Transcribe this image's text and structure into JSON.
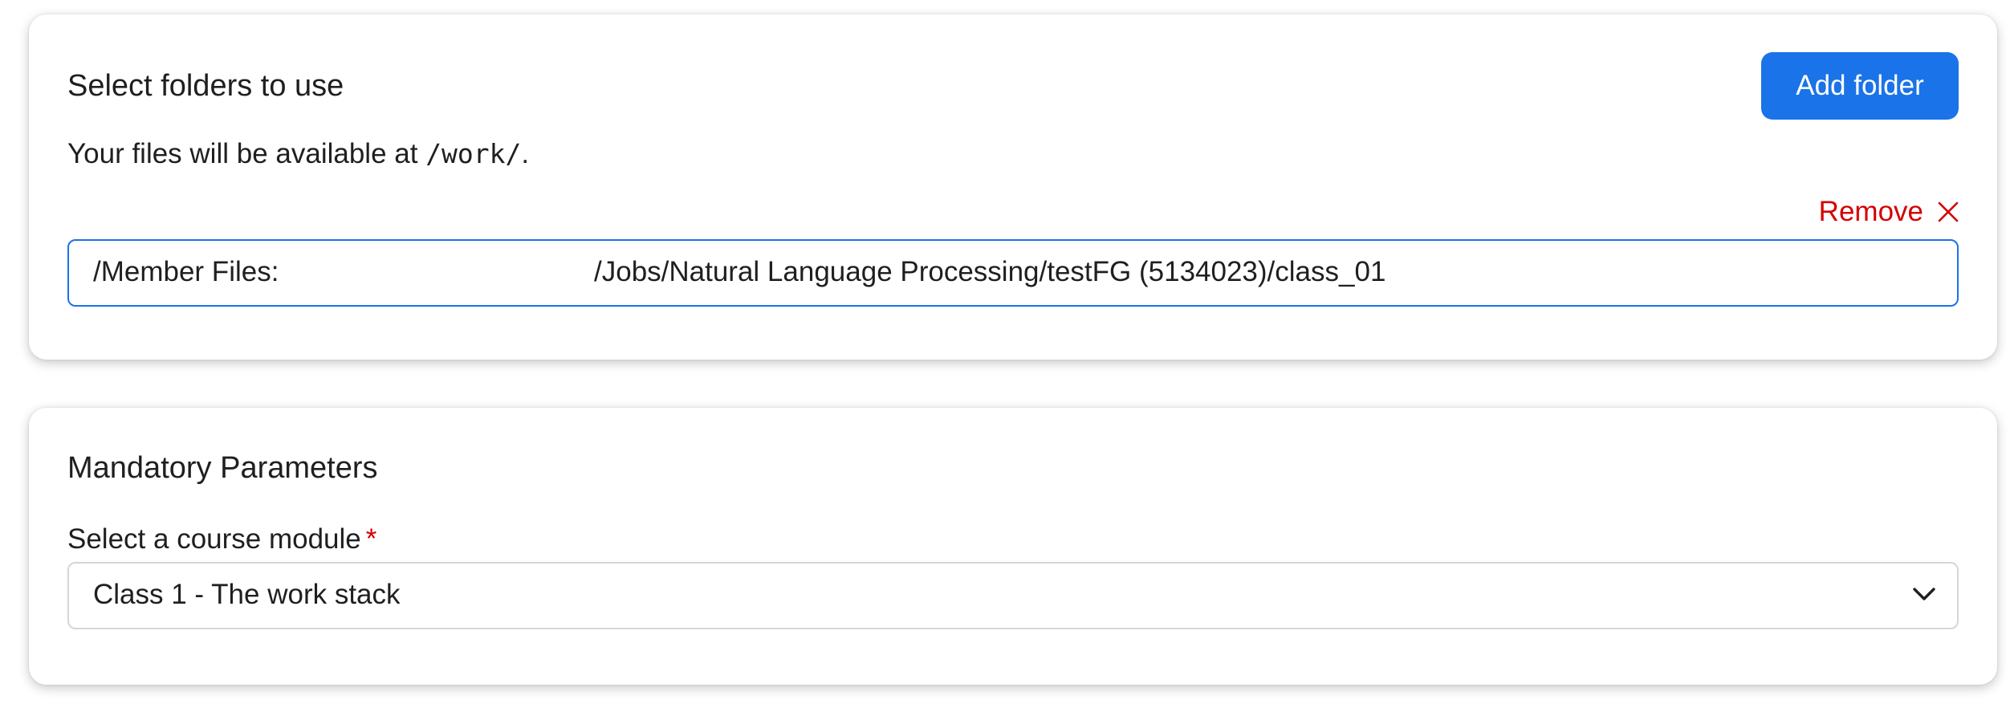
{
  "folders_section": {
    "title": "Select folders to use",
    "add_folder_label": "Add folder",
    "info_prefix": "Your files will be available at ",
    "info_path": "/work/",
    "info_suffix": ".",
    "remove_label": "Remove",
    "remove_icon": "close-icon",
    "folder_prefix": "/Member Files:",
    "folder_path": "/Jobs/Natural Language Processing/testFG (5134023)/class_01"
  },
  "parameters_section": {
    "title": "Mandatory Parameters",
    "course_module_label": "Select a course module",
    "required_marker": "*",
    "course_module_value": "Class 1 - The work stack",
    "dropdown_icon": "chevron-down-icon"
  },
  "colors": {
    "primary": "#1a73e8",
    "danger": "#d40000",
    "text": "#1f1f1f",
    "border": "#d6d6d6"
  }
}
